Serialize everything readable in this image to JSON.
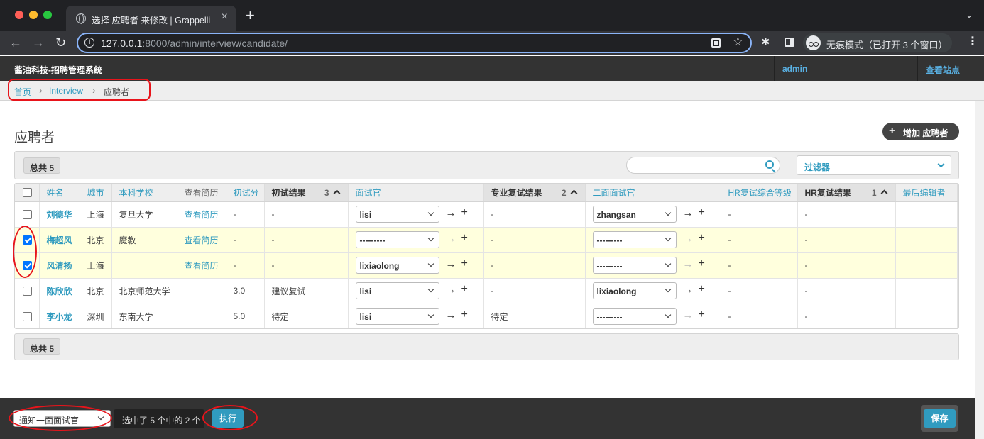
{
  "browser": {
    "tab_title": "选择 应聘者 来修改 | Grappelli",
    "tab_close": "×",
    "new_tab": "+",
    "tab_search": "⌄",
    "url_host": "127.0.0.1",
    "url_rest": ":8000/admin/interview/candidate/",
    "info_glyph": "i",
    "star_glyph": "☆",
    "extension_glyph": "✱",
    "incognito_label": "无痕模式（已打开 3 个窗口）",
    "back_glyph": "←",
    "forward_glyph": "→",
    "reload_glyph": "↻",
    "menu_glyph": "⋮"
  },
  "header": {
    "brand": "酱油科技-招聘管理系统",
    "user": "admin",
    "view_site": "查看站点"
  },
  "breadcrumbs": {
    "home": "首页",
    "sep": "›",
    "app": "Interview",
    "current": "应聘者"
  },
  "page": {
    "title": "应聘者",
    "add_plus": "+",
    "add_label": "增加 应聘者",
    "count_label": "总共 5",
    "search_placeholder": "",
    "filter_label": "过滤器"
  },
  "table": {
    "headers": {
      "name": "姓名",
      "city": "城市",
      "school": "本科学校",
      "resume": "查看简历",
      "first_score": "初试分",
      "first_result": "初试结果",
      "first_result_order": "3",
      "interviewer": "面试官",
      "second_result": "专业复试结果",
      "second_result_order": "2",
      "second_interviewer": "二面面试官",
      "hr_level": "HR复试综合等级",
      "hr_result": "HR复试结果",
      "hr_result_order": "1",
      "last_editor": "最后编辑者"
    },
    "rows": [
      {
        "selected": false,
        "name": "刘德华",
        "city": "上海",
        "school": "复旦大学",
        "resume": "查看简历",
        "first_score": "-",
        "first_result": "-",
        "interviewer": "lisi",
        "second_result": "-",
        "second_interviewer": "zhangsan",
        "hr_level": "-",
        "hr_result": "-",
        "last_editor": ""
      },
      {
        "selected": true,
        "name": "梅超风",
        "city": "北京",
        "school": "魔教",
        "resume": "查看简历",
        "first_score": "-",
        "first_result": "-",
        "interviewer": "---------",
        "second_result": "-",
        "second_interviewer": "---------",
        "hr_level": "-",
        "hr_result": "-",
        "last_editor": ""
      },
      {
        "selected": true,
        "name": "风清扬",
        "city": "上海",
        "school": "",
        "resume": "查看简历",
        "first_score": "-",
        "first_result": "-",
        "interviewer": "lixiaolong",
        "second_result": "-",
        "second_interviewer": "---------",
        "hr_level": "-",
        "hr_result": "-",
        "last_editor": ""
      },
      {
        "selected": false,
        "name": "陈欣欣",
        "city": "北京",
        "school": "北京师范大学",
        "resume": "",
        "first_score": "3.0",
        "first_result": "建议复试",
        "interviewer": "lisi",
        "second_result": "-",
        "second_interviewer": "lixiaolong",
        "hr_level": "-",
        "hr_result": "-",
        "last_editor": ""
      },
      {
        "selected": false,
        "name": "李小龙",
        "city": "深圳",
        "school": "东南大学",
        "resume": "",
        "first_score": "5.0",
        "first_result": "待定",
        "interviewer": "lisi",
        "second_result": "待定",
        "second_interviewer": "---------",
        "hr_level": "-",
        "hr_result": "-",
        "last_editor": ""
      }
    ],
    "fk_arrow": "→",
    "fk_plus": "+"
  },
  "footer": {
    "action_selected": "通知一面面试官",
    "selection_counter": "选中了 5 个中的 2 个",
    "go_label": "执行",
    "save_label": "保存"
  },
  "colors": {
    "accent": "#309bbf",
    "header_bg": "#333333",
    "selected_row": "#ffffdd",
    "annotation": "#e8141b"
  }
}
